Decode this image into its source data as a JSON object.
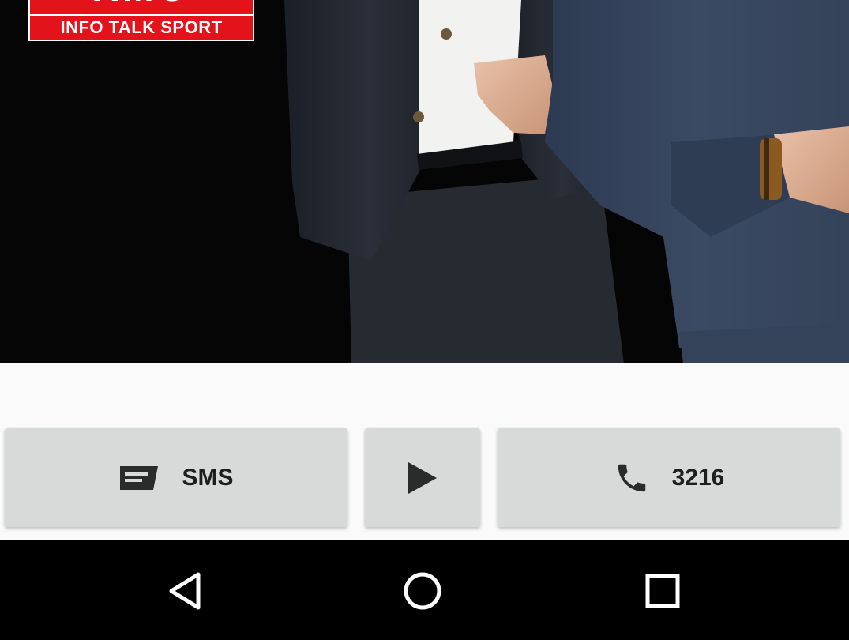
{
  "hero": {
    "logo_brand": "RMC",
    "logo_tagline": "INFO TALK SPORT"
  },
  "actions": {
    "sms_label": "SMS",
    "call_label": "3216",
    "sms_icon": "message-icon",
    "play_icon": "play-icon",
    "call_icon": "phone-icon"
  },
  "navbar": {
    "back_icon": "back-icon",
    "home_icon": "home-icon",
    "recents_icon": "recents-icon"
  },
  "colors": {
    "brand_red": "#e3131b",
    "button_bg": "#d8d9d9",
    "icon_dark": "#2b2b2b"
  }
}
